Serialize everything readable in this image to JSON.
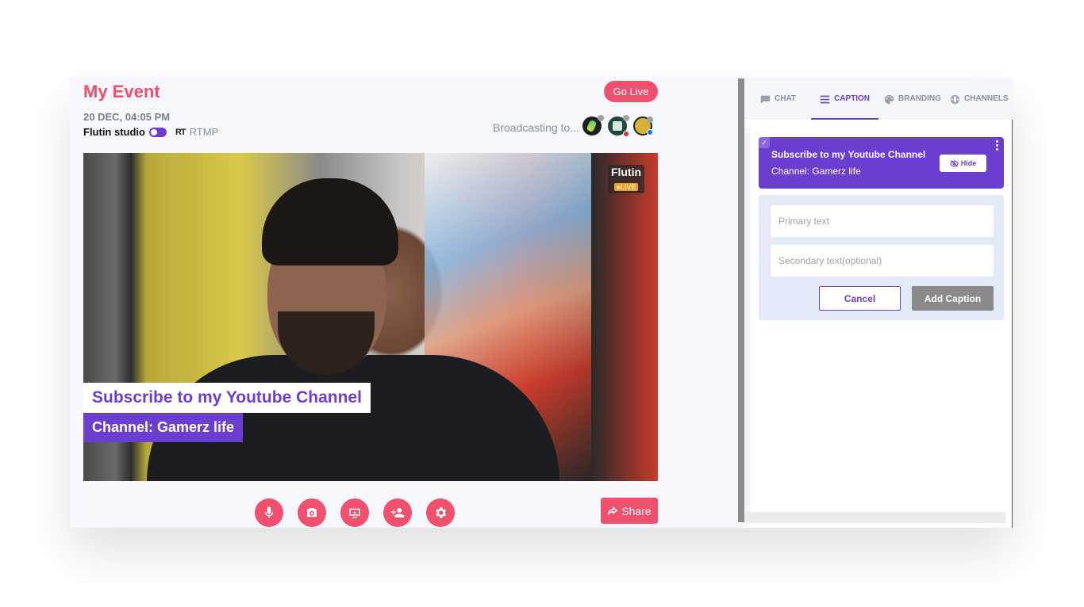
{
  "event": {
    "title": "My Event",
    "datetime": "20 DEC, 04:05 PM",
    "studio_label": "Flutin studio",
    "rtmp_icon": "RT",
    "rtmp_label": "RTMP",
    "go_live_label": "Go Live",
    "broadcasting_label": "Broadcasting to..."
  },
  "video": {
    "badge_name": "Flutin",
    "badge_live": "●LIVE",
    "caption_primary": "Subscribe to my Youtube Channel",
    "caption_secondary": "Channel: Gamerz life"
  },
  "controls": {
    "icons": [
      "microphone-icon",
      "camera-icon",
      "screen-share-icon",
      "add-guest-icon",
      "settings-icon"
    ],
    "share_label": "Share"
  },
  "tabs": [
    {
      "label": "CHAT",
      "icon": "chat-icon"
    },
    {
      "label": "CAPTION",
      "icon": "caption-icon",
      "active": true
    },
    {
      "label": "BRANDING",
      "icon": "palette-icon"
    },
    {
      "label": "CHANNELS",
      "icon": "globe-icon"
    }
  ],
  "caption_panel": {
    "card_primary": "Subscribe to my Youtube Channel",
    "card_secondary": "Channel: Gamerz life",
    "hide_label": "Hide",
    "primary_placeholder": "Primary text",
    "secondary_placeholder": "Secondary text(optional)",
    "cancel_label": "Cancel",
    "add_label": "Add Caption"
  },
  "colors": {
    "accent": "#f0506e",
    "brand": "#6a3fd0"
  }
}
